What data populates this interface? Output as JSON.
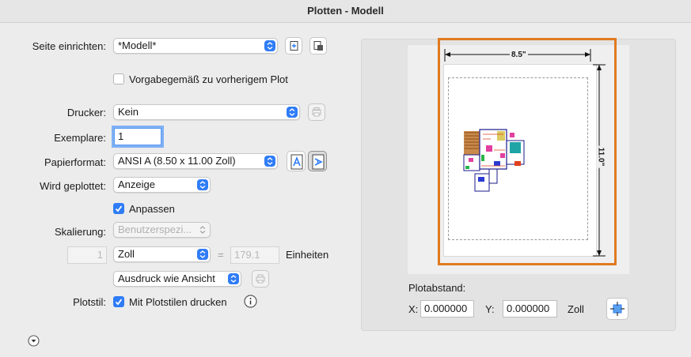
{
  "window": {
    "title": "Plotten - Modell"
  },
  "page_setup": {
    "label": "Seite einrichten:",
    "value": "*Modell*"
  },
  "default_checkbox": {
    "label": "Vorgabegemäß zu vorherigem Plot",
    "checked": false
  },
  "printer": {
    "label": "Drucker:",
    "value": "Kein"
  },
  "copies": {
    "label": "Exemplare:",
    "value": "1"
  },
  "paper_size": {
    "label": "Papierformat:",
    "value": "ANSI A (8.50 x 11.00 Zoll)"
  },
  "plot_area": {
    "label": "Wird geplottet:",
    "value": "Anzeige"
  },
  "fit": {
    "label": "Anpassen",
    "checked": true
  },
  "scale": {
    "label": "Skalierung:",
    "value": "Benutzerspezi...",
    "left_value": "1",
    "unit": "Zoll",
    "equals": "=",
    "right_value": "179.1",
    "units_label": "Einheiten"
  },
  "output": {
    "value": "Ausdruck wie Ansicht"
  },
  "plot_style": {
    "label": "Plotstil:",
    "checkbox_label": "Mit Plotstilen drucken",
    "checked": true
  },
  "preview": {
    "width_label": "8.5\"",
    "height_label": "11.0\""
  },
  "offset": {
    "label": "Plotabstand:",
    "x_label": "X:",
    "x_value": "0.000000",
    "y_label": "Y:",
    "y_value": "0.000000",
    "unit": "Zoll"
  },
  "colors": {
    "accent": "#2f7cf6",
    "highlight_frame": "#e07a1f"
  },
  "icons": [
    "add-page-setup-icon",
    "import-page-setup-icon",
    "printer-properties-icon",
    "portrait-orientation-icon",
    "landscape-orientation-icon",
    "output-settings-icon",
    "info-icon",
    "center-plot-icon",
    "expand-disclosure-icon"
  ]
}
